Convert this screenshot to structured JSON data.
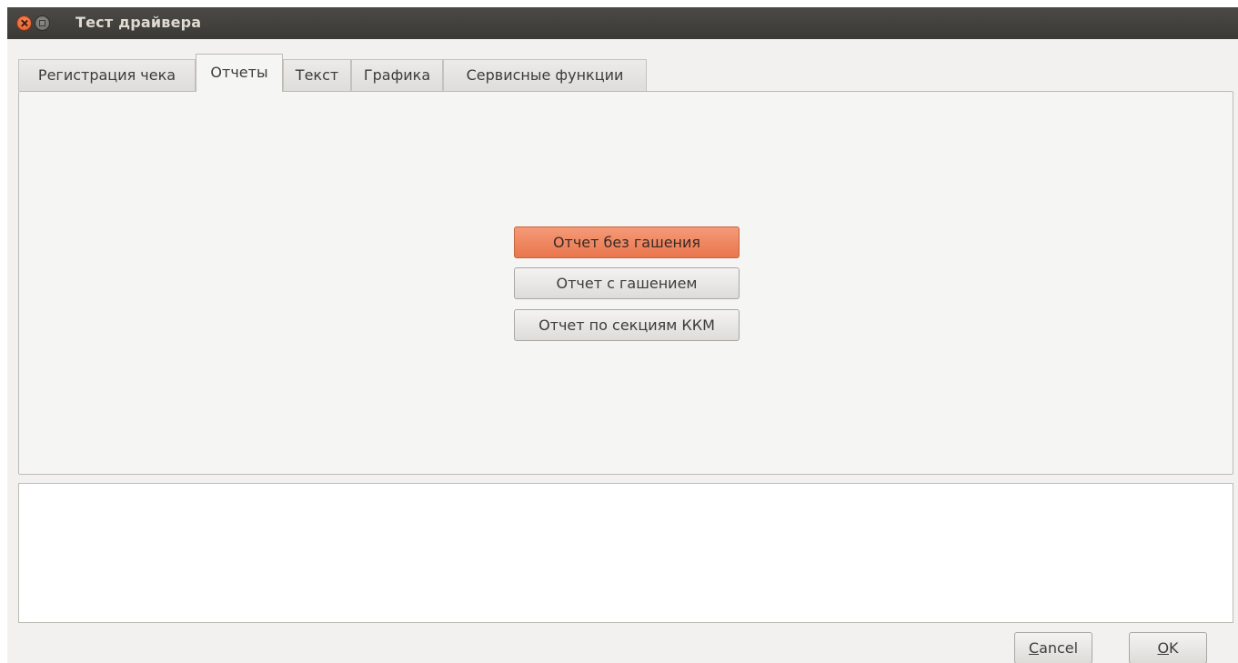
{
  "window": {
    "title": "Тест драйвера"
  },
  "tabs": [
    {
      "label": "Регистрация чека",
      "active": false
    },
    {
      "label": "Отчеты",
      "active": true
    },
    {
      "label": "Текст",
      "active": false
    },
    {
      "label": "Графика",
      "active": false
    },
    {
      "label": "Сервисные функции",
      "active": false
    }
  ],
  "reports": {
    "buttons": [
      {
        "label": "Отчет без гашения",
        "highlighted": true
      },
      {
        "label": "Отчет с гашением",
        "highlighted": false
      },
      {
        "label": "Отчет по секциям ККМ",
        "highlighted": false
      }
    ]
  },
  "output": {
    "text": ""
  },
  "dialog": {
    "cancel_mnemonic": "C",
    "cancel_rest": "ancel",
    "ok_mnemonic": "O",
    "ok_rest": "K"
  },
  "colors": {
    "titlebar": "#3c3b37",
    "highlight": "#ee7f55",
    "window_bg": "#f2f1f0"
  }
}
